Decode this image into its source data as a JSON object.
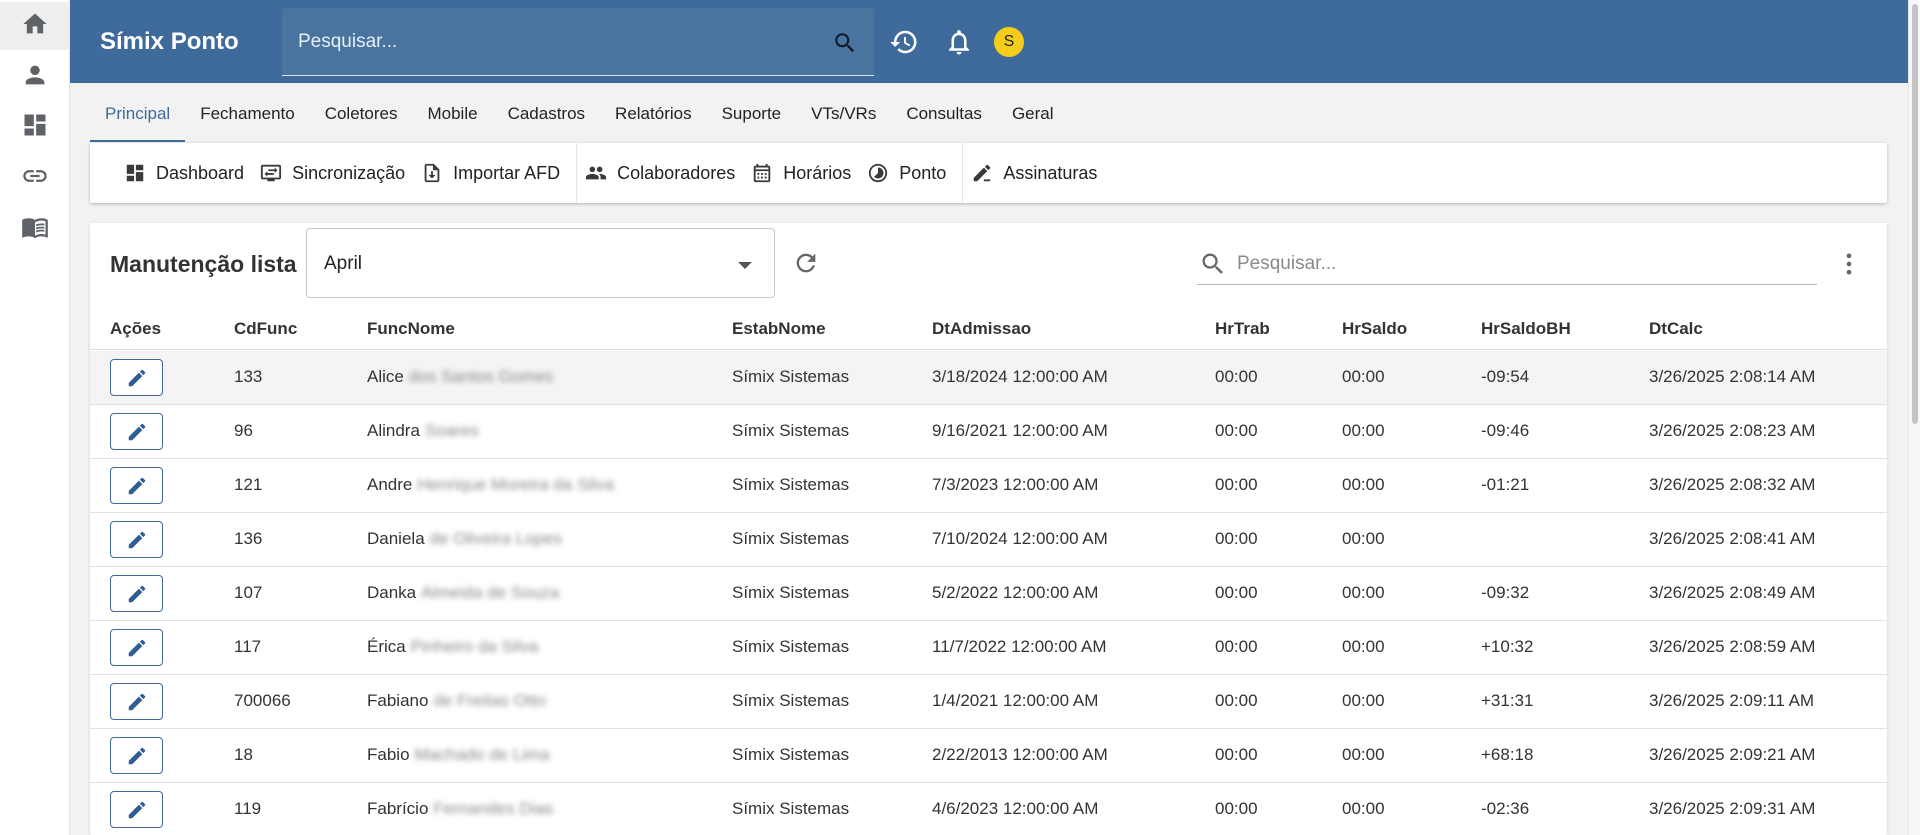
{
  "app": {
    "title": "Símix Ponto",
    "avatar_letter": "S"
  },
  "colors": {
    "appbar": "#3e6b9b",
    "accent": "#3e6b9b",
    "avatar": "#f5cc1a"
  },
  "rail": {
    "icons": [
      "home-icon",
      "person-icon",
      "dashboard-icon",
      "link-icon",
      "book-icon"
    ]
  },
  "top_search": {
    "placeholder": "Pesquisar..."
  },
  "tabs": [
    {
      "label": "Principal",
      "active": true
    },
    {
      "label": "Fechamento"
    },
    {
      "label": "Coletores"
    },
    {
      "label": "Mobile"
    },
    {
      "label": "Cadastros"
    },
    {
      "label": "Relatórios"
    },
    {
      "label": "Suporte"
    },
    {
      "label": "VTs/VRs"
    },
    {
      "label": "Consultas"
    },
    {
      "label": "Geral"
    }
  ],
  "submenu": [
    {
      "label": "Dashboard",
      "icon": "dashboard-icon"
    },
    {
      "label": "Sincronização",
      "icon": "sync-screen-icon"
    },
    {
      "label": "Importar AFD",
      "icon": "import-file-icon"
    },
    {
      "label": "Colaboradores",
      "icon": "people-icon"
    },
    {
      "label": "Horários",
      "icon": "calendar-icon"
    },
    {
      "label": "Ponto",
      "icon": "timelapse-icon"
    },
    {
      "label": "Assinaturas",
      "icon": "signature-icon"
    }
  ],
  "main": {
    "title": "Manutenção lista",
    "month_select": "April",
    "search_placeholder": "Pesquisar..."
  },
  "table": {
    "columns": [
      "Ações",
      "CdFunc",
      "FuncNome",
      "EstabNome",
      "DtAdmissao",
      "HrTrab",
      "HrSaldo",
      "HrSaldoBH",
      "DtCalc"
    ],
    "rows": [
      {
        "cdfunc": "133",
        "first": "Alice",
        "rest": "dos Santos Gomes",
        "estab": "Símix Sistemas",
        "adm": "3/18/2024 12:00:00 AM",
        "hrtrab": "00:00",
        "hrsaldo": "00:00",
        "bh": "-09:54",
        "calc": "3/26/2025 2:08:14 AM"
      },
      {
        "cdfunc": "96",
        "first": "Alindra",
        "rest": "Soares",
        "estab": "Símix Sistemas",
        "adm": "9/16/2021 12:00:00 AM",
        "hrtrab": "00:00",
        "hrsaldo": "00:00",
        "bh": "-09:46",
        "calc": "3/26/2025 2:08:23 AM"
      },
      {
        "cdfunc": "121",
        "first": "Andre",
        "rest": "Henrique Moreira da Silva",
        "estab": "Símix Sistemas",
        "adm": "7/3/2023 12:00:00 AM",
        "hrtrab": "00:00",
        "hrsaldo": "00:00",
        "bh": "-01:21",
        "calc": "3/26/2025 2:08:32 AM"
      },
      {
        "cdfunc": "136",
        "first": "Daniela",
        "rest": "de Oliveira Lopes",
        "estab": "Símix Sistemas",
        "adm": "7/10/2024 12:00:00 AM",
        "hrtrab": "00:00",
        "hrsaldo": "00:00",
        "bh": "",
        "calc": "3/26/2025 2:08:41 AM"
      },
      {
        "cdfunc": "107",
        "first": "Danka",
        "rest": "Almeida de Souza",
        "estab": "Símix Sistemas",
        "adm": "5/2/2022 12:00:00 AM",
        "hrtrab": "00:00",
        "hrsaldo": "00:00",
        "bh": "-09:32",
        "calc": "3/26/2025 2:08:49 AM"
      },
      {
        "cdfunc": "117",
        "first": "Érica",
        "rest": "Pinheiro da Silva",
        "estab": "Símix Sistemas",
        "adm": "11/7/2022 12:00:00 AM",
        "hrtrab": "00:00",
        "hrsaldo": "00:00",
        "bh": "+10:32",
        "calc": "3/26/2025 2:08:59 AM"
      },
      {
        "cdfunc": "700066",
        "first": "Fabiano",
        "rest": "de Freitas Otto",
        "estab": "Símix Sistemas",
        "adm": "1/4/2021 12:00:00 AM",
        "hrtrab": "00:00",
        "hrsaldo": "00:00",
        "bh": "+31:31",
        "calc": "3/26/2025 2:09:11 AM"
      },
      {
        "cdfunc": "18",
        "first": "Fabio",
        "rest": "Machado de Lima",
        "estab": "Símix Sistemas",
        "adm": "2/22/2013 12:00:00 AM",
        "hrtrab": "00:00",
        "hrsaldo": "00:00",
        "bh": "+68:18",
        "calc": "3/26/2025 2:09:21 AM"
      },
      {
        "cdfunc": "119",
        "first": "Fabrício",
        "rest": "Fernandes Dias",
        "estab": "Símix Sistemas",
        "adm": "4/6/2023 12:00:00 AM",
        "hrtrab": "00:00",
        "hrsaldo": "00:00",
        "bh": "-02:36",
        "calc": "3/26/2025 2:09:31 AM"
      }
    ]
  }
}
